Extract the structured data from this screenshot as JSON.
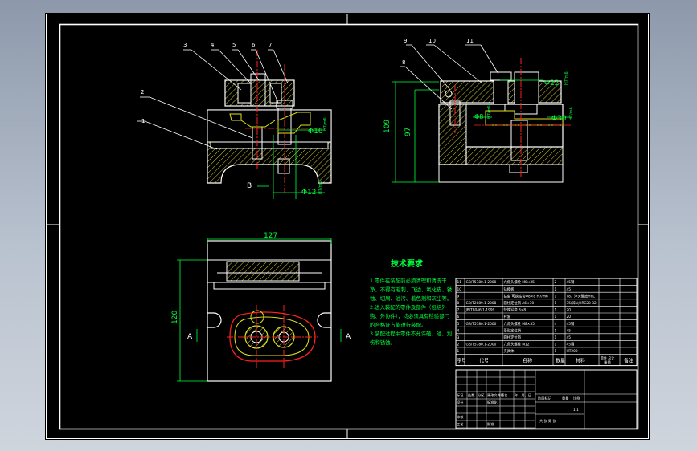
{
  "drawing": {
    "part_labels": [
      "1",
      "2",
      "3",
      "4",
      "5",
      "6",
      "7",
      "8",
      "9",
      "10",
      "11"
    ],
    "section_marker": "B",
    "section_marker_left": "A",
    "section_marker_right": "A",
    "dimensions": {
      "bore_d16": "Φ16",
      "bore_d16_fit": "H7/m6",
      "bore_d12": "Φ12",
      "bore_d12_fit": "H7/m6",
      "bore_d22": "Φ22",
      "bore_d22_fit": "H7/m6",
      "bore_d8": "Φ8",
      "bore_d8_fit": "H7/m6",
      "bore_d30": "Φ30",
      "bore_d30_fit": "H7/m6",
      "height_total": "109",
      "height_inner": "97",
      "width_top": "127",
      "height_plan": "120"
    }
  },
  "notes": {
    "title": "技术要求",
    "lines": [
      "1.零件在装配前必须清理和清洗干",
      "净，不得有毛刺、飞边、氧化皮、锈",
      "蚀、切屑、油污、着色剂和灰尘等。",
      "2.进入装配的零件及部件（包括外",
      "购、外协件），均必须具有检验部门",
      "的合格证方能进行装配。",
      "3.装配过程中零件不允许磕、碰、划",
      "伤和锈蚀。"
    ]
  },
  "bom": {
    "rows": [
      {
        "no": "11",
        "code": "GB/T5780.1-2000",
        "name": "六角头螺栓 M8×35",
        "qty": "2",
        "material": "45钢",
        "remark": ""
      },
      {
        "no": "10",
        "code": "",
        "name": "钻模板",
        "qty": "1",
        "material": "45",
        "remark": ""
      },
      {
        "no": "9",
        "code": "",
        "name": "钻套 可换钻套Φ8×8 H7/m6",
        "qty": "1",
        "material": "T8，淬火硬度HRC",
        "remark": ""
      },
      {
        "no": "8",
        "code": "GB/T2089.1-2008",
        "name": "圆柱定位销 A6×30",
        "qty": "1",
        "material": "35(淬火HRC28-32)",
        "remark": ""
      },
      {
        "no": "7",
        "code": "JB/T8046.1-1999",
        "name": "快换钻套 8×8",
        "qty": "1",
        "material": "20",
        "remark": ""
      },
      {
        "no": "6",
        "code": "",
        "name": "衬套",
        "qty": "1",
        "material": "20",
        "remark": ""
      },
      {
        "no": "5",
        "code": "GB/T5780.1-2000",
        "name": "六角头螺栓 M8×35",
        "qty": "4",
        "material": "45钢",
        "remark": ""
      },
      {
        "no": "4",
        "code": "",
        "name": "菱形定位销",
        "qty": "1",
        "material": "45",
        "remark": ""
      },
      {
        "no": "3",
        "code": "",
        "name": "圆柱定位销",
        "qty": "1",
        "material": "45",
        "remark": ""
      },
      {
        "no": "2",
        "code": "GB/T5780.1-2000",
        "name": "六角头螺栓 M12",
        "qty": "1",
        "material": "45钢",
        "remark": ""
      },
      {
        "no": "1",
        "code": "",
        "name": "夹具体",
        "qty": "1",
        "material": "HT200",
        "remark": ""
      }
    ],
    "header": {
      "no": "序号",
      "code": "代号",
      "name": "名称",
      "qty": "数量",
      "material": "材料",
      "weight": "单件 总计",
      "weight_sub": "重量",
      "remark": "备注"
    }
  },
  "title_block": {
    "row1": [
      "标记",
      "处数",
      "分区",
      "更改文件号",
      "签名",
      "年、月、日"
    ],
    "row2": [
      "设计",
      "",
      "",
      "标准化",
      ""
    ],
    "row3": [
      "审核"
    ],
    "row4": [
      "工艺",
      "",
      "",
      "批准"
    ],
    "stage_label": "阶段标记",
    "weight_label": "重量",
    "scale_label": "比例",
    "scale_value": "1:1",
    "sheet_label": "共 张 第 张"
  },
  "colors": {
    "background": "#000000",
    "lines": "#ffffff",
    "dimension": "#00ff3c",
    "center_line": "#ff2020",
    "hatch": "#d2cc30",
    "hidden": "#e0e020",
    "notes": "#00ff3c"
  }
}
